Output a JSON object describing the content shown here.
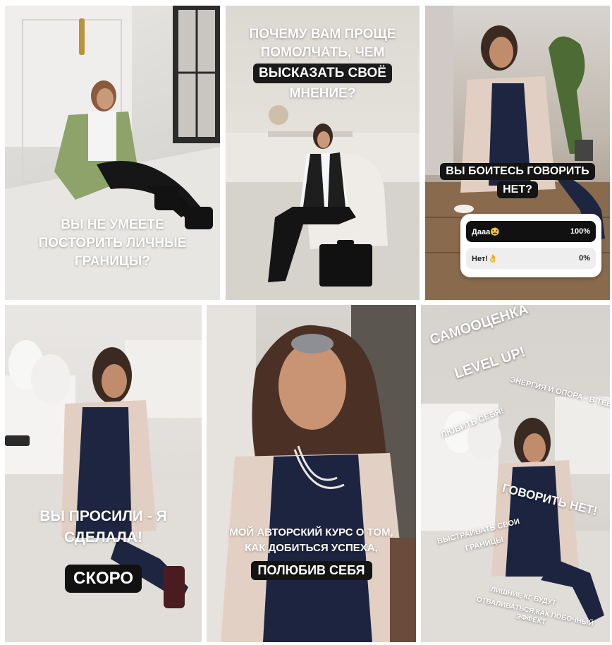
{
  "panels": [
    {
      "headline": [
        "ВЫ НЕ УМЕЕТЕ",
        "ПОСТОРИТЬ ЛИЧНЫЕ",
        "ГРАНИЦЫ?"
      ]
    },
    {
      "headline": [
        "ПОЧЕМУ ВАМ ПРОЩЕ",
        "ПОМОЛЧАТЬ, ЧЕМ",
        "ВЫСКАЗАТЬ СВОЁ",
        "МНЕНИЕ?"
      ]
    },
    {
      "question": [
        "ВЫ БОИТЕСЬ ГОВОРИТЬ",
        "НЕТ?"
      ],
      "poll": {
        "options": [
          {
            "label": "Дааа😫",
            "percent": "100%"
          },
          {
            "label": "Нет!👌",
            "percent": "0%"
          }
        ]
      }
    },
    {
      "headline": [
        "ВЫ ПРОСИЛИ - Я",
        "СДЕЛАЛА!"
      ],
      "badge": "СКОРО"
    },
    {
      "headline": [
        "МОЙ АВТОРСКИЙ КУРС О ТОМ,",
        "КАК ДОБИТЬСЯ УСПЕХА,"
      ],
      "highlight": "ПОЛЮБИВ СЕБЯ"
    },
    {
      "tags": [
        "САМООЦЕНКА",
        "LEVEL UP!",
        "ЭНЕРГИЯ И ОПОРА - В ТЕБЕ!",
        "ЛЮБИТЬ СЕБЯ!",
        "ГОВОРИТЬ НЕТ!",
        "ВЫСТРАИВАТЬ СВОИ",
        "ГРАНИЦЫ",
        "ЛИШНИЕ КГ БУДУТ",
        "ОТВАЛИВАТЬСЯ,КАК ПОБОЧНЫЙ",
        "ЭФФЕКТ"
      ]
    }
  ]
}
